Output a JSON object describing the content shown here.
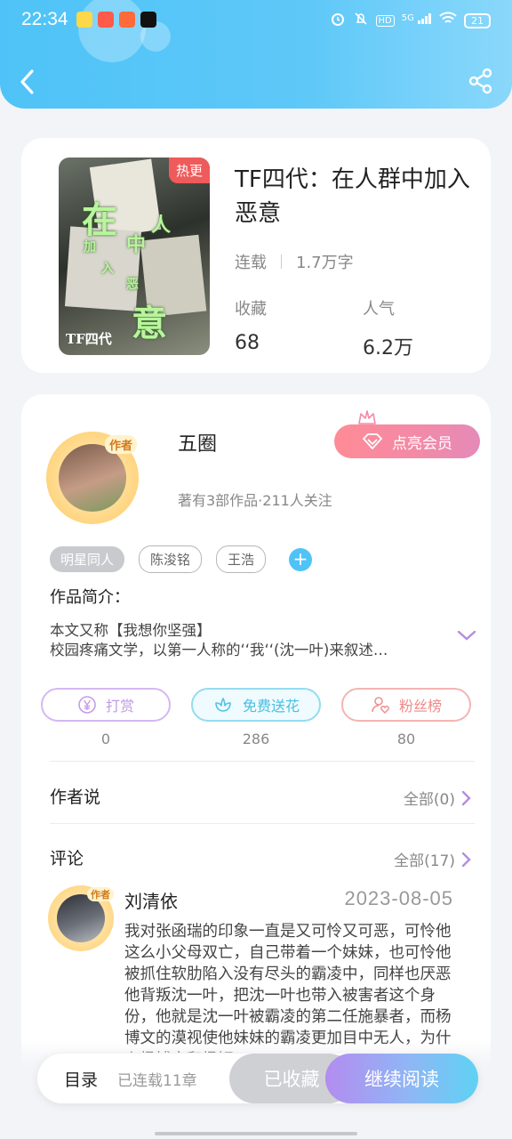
{
  "status_bar": {
    "time": "22:34",
    "signal_label": "5G",
    "battery": "21"
  },
  "book": {
    "hot_badge": "热更",
    "title": "TF四代：在人群中加入恶意",
    "status": "连载",
    "word_count": "1.7万字",
    "stats": [
      {
        "label": "收藏",
        "value": "68"
      },
      {
        "label": "人气",
        "value": "6.2万"
      }
    ],
    "cover_chars": [
      "在",
      "人",
      "中",
      "加",
      "入",
      "恶",
      "意"
    ],
    "cover_logo": "TF四代"
  },
  "author": {
    "badge": "作者",
    "name": "五圈",
    "info": "著有3部作品·211人关注",
    "vip_label": "点亮会员"
  },
  "tags": [
    "明星同人",
    "陈浚铭",
    "王浩"
  ],
  "intro": {
    "title": "作品简介：",
    "line1": "本文又称【我想你坚强】",
    "line2": "校园疼痛文学，以第一人称的‘‘我‘‘(沈一叶)来叙述…"
  },
  "actions": [
    {
      "label": "打赏",
      "count": "0",
      "color": "#c79be8"
    },
    {
      "label": "免费送花",
      "count": "286",
      "color": "#4fc3e8"
    },
    {
      "label": "粉丝榜",
      "count": "80",
      "color": "#f09090"
    }
  ],
  "author_says": {
    "title": "作者说",
    "more": "全部(0)"
  },
  "comments": {
    "title": "评论",
    "more": "全部(17)",
    "first": {
      "badge": "作者",
      "user": "刘清依",
      "date": "2023-08-05",
      "text": "我对张函瑞的印象一直是又可怜又可恶，可怜他这么小父母双亡，自己带着一个妹妹，也可怜他被抓住软肋陷入没有尽头的霸凌中，同样也厌恶他背叛沈一叶，把沈一叶也带入被害者这个身份，他就是沈一叶被霸凌的第二任施暴者，而杨博文的漠视使他妹妹的霸凌更加目中无人，为什么杨博文和杨钰"
    }
  },
  "bottom_bar": {
    "toc": "目录",
    "toc_status": "已连载11章",
    "collected": "已收藏",
    "continue": "继续阅读"
  }
}
